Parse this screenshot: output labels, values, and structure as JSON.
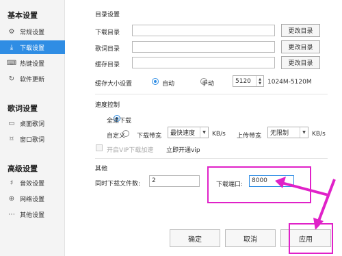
{
  "sidebar": {
    "basic_title": "基本设置",
    "basic_items": [
      {
        "label": "常规设置",
        "icon": "gear-icon"
      },
      {
        "label": "下载设置",
        "icon": "download-icon",
        "active": true
      },
      {
        "label": "热键设置",
        "icon": "keyboard-icon"
      },
      {
        "label": "软件更新",
        "icon": "update-icon"
      }
    ],
    "lyrics_title": "歌词设置",
    "lyrics_items": [
      {
        "label": "桌面歌词",
        "icon": "desktop-lyrics-icon"
      },
      {
        "label": "窗口歌词",
        "icon": "window-lyrics-icon"
      }
    ],
    "advanced_title": "高级设置",
    "advanced_items": [
      {
        "label": "音效设置",
        "icon": "equalizer-icon"
      },
      {
        "label": "网络设置",
        "icon": "network-icon"
      },
      {
        "label": "其他设置",
        "icon": "more-icon"
      }
    ]
  },
  "directory": {
    "title": "目录设置",
    "download_label": "下载目录",
    "lyrics_label": "歌词目录",
    "cache_label": "缓存目录",
    "change_label": "更改目录",
    "cache_size_label": "缓存大小设置",
    "auto_label": "自动",
    "manual_label": "手动",
    "cache_value": "5120",
    "cache_range": "1024M-5120M"
  },
  "speed": {
    "title": "速度控制",
    "full_speed_label": "全速下载",
    "custom_label": "自定义",
    "download_bw_label": "下载带宽",
    "download_bw_value": "最快速度",
    "unit1": "KB/s",
    "upload_bw_label": "上传带宽",
    "upload_bw_value": "无限制",
    "unit2": "KB/s",
    "vip_accel_label": "开启VIP下载加速",
    "vip_link": "立即开通vip"
  },
  "other": {
    "title": "其他",
    "concurrent_label": "同时下载文件数:",
    "concurrent_value": "2",
    "port_label": "下载端口:",
    "port_value": "8000"
  },
  "buttons": {
    "ok": "确定",
    "cancel": "取消",
    "apply": "应用"
  },
  "colors": {
    "accent": "#2f8de4",
    "annotation": "#e021c8"
  }
}
